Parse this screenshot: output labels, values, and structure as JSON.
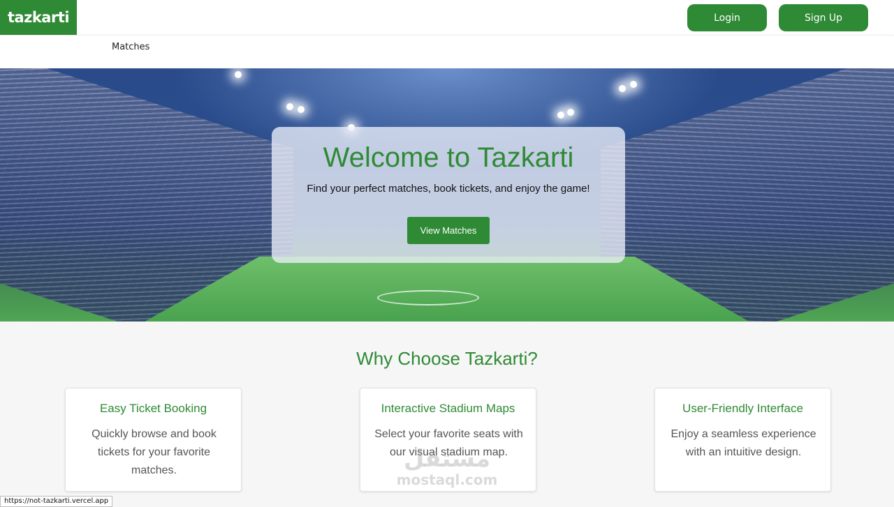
{
  "header": {
    "logo_text": "tazkarti",
    "login_label": "Login",
    "signup_label": "Sign Up"
  },
  "nav": {
    "matches_label": "Matches"
  },
  "hero": {
    "title": "Welcome to Tazkarti",
    "subtitle": "Find your perfect matches, book tickets, and enjoy the game!",
    "cta_label": "View Matches"
  },
  "features": {
    "heading": "Why Choose Tazkarti?",
    "items": [
      {
        "title": "Easy Ticket Booking",
        "description": "Quickly browse and book tickets for your favorite matches."
      },
      {
        "title": "Interactive Stadium Maps",
        "description": "Select your favorite seats with our visual stadium map."
      },
      {
        "title": "User-Friendly Interface",
        "description": "Enjoy a seamless experience with an intuitive design."
      }
    ]
  },
  "watermark": {
    "arabic": "مستقل",
    "latin": "mostaql.com"
  },
  "status_bar": {
    "url": "https://not-tazkarti.vercel.app"
  },
  "colors": {
    "brand_green": "#2f8a35",
    "page_background": "#f6f6f6"
  },
  "icons": {
    "hero_background": "stadium-background-image"
  }
}
